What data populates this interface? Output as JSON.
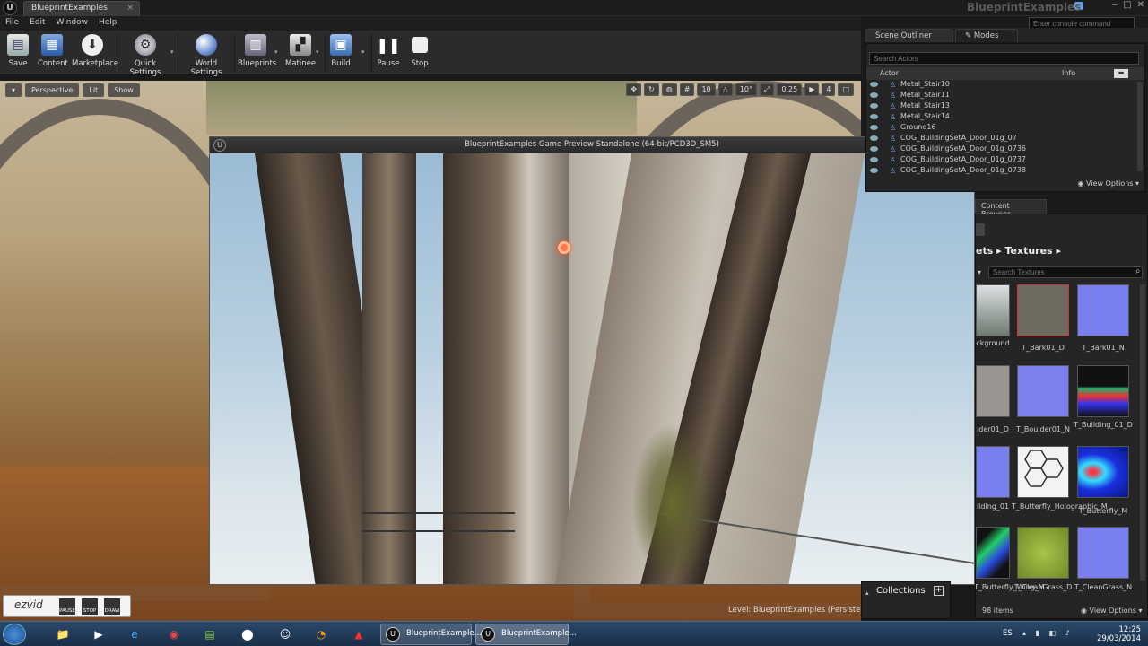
{
  "window": {
    "logo": "U",
    "tab_label": "BlueprintExamples",
    "app_title": "BlueprintExamples",
    "console_placeholder": "Enter console command"
  },
  "menu": [
    "File",
    "Edit",
    "Window",
    "Help"
  ],
  "toolbar": [
    {
      "label": "Save",
      "icon": "save-icon"
    },
    {
      "label": "Content",
      "icon": "content-icon"
    },
    {
      "label": "Marketplace",
      "icon": "marketplace-icon"
    },
    {
      "label": "Quick Settings",
      "icon": "quick-settings-icon"
    },
    {
      "label": "World Settings",
      "icon": "world-settings-icon"
    },
    {
      "label": "Blueprints",
      "icon": "blueprints-icon"
    },
    {
      "label": "Matinee",
      "icon": "matinee-icon"
    },
    {
      "label": "Build",
      "icon": "build-icon"
    },
    {
      "label": "Pause",
      "icon": "pause-icon"
    },
    {
      "label": "Stop",
      "icon": "stop-icon"
    }
  ],
  "viewport": {
    "perspective": "Perspective",
    "lit": "Lit",
    "show": "Show",
    "grid_snap": "10",
    "rot_snap": "10°",
    "scale_snap": "0,25",
    "cam_speed": "4",
    "level_prefix": "Level:",
    "level_name": "BlueprintExamples (Persistent)"
  },
  "recorder": {
    "logo": "ezvid",
    "buttons": [
      "PAUSE",
      "STOP",
      "DRAW"
    ]
  },
  "game_preview": {
    "title": "BlueprintExamples Game Preview Standalone (64-bit/PCD3D_SM5)"
  },
  "outliner": {
    "tab_label": "Scene Outliner",
    "modes_label": "Modes",
    "search_placeholder": "Search Actors",
    "col_actor": "Actor",
    "col_info": "Info",
    "rows": [
      "Metal_Stair10",
      "Metal_Stair11",
      "Metal_Stair13",
      "Metal_Stair14",
      "Ground16",
      "COG_BuildingSetA_Door_01g_07",
      "COG_BuildingSetA_Door_01g_0736",
      "COG_BuildingSetA_Door_01g_0737",
      "COG_BuildingSetA_Door_01g_0738"
    ],
    "view_options": "View Options"
  },
  "content_browser": {
    "tab_label": "Content Browser",
    "breadcrumb": "ets",
    "current_folder": "Textures",
    "search_placeholder": "Search Textures",
    "tiles": [
      {
        "label": "ckground",
        "color": "#cfd3d6"
      },
      {
        "label": "T_Bark01_D",
        "color": "#6f6a60"
      },
      {
        "label": "T_Bark01_N",
        "color": "#7a7ff0"
      },
      {
        "label": "lder01_D",
        "color": "#9a9590"
      },
      {
        "label": "T_Boulder01_N",
        "color": "#7c80ee"
      },
      {
        "label": "T_Building_01_D",
        "color": "#1a1a1a"
      },
      {
        "label": "ilding_01",
        "color": "#7a7ff0"
      },
      {
        "label": "T_Butterfly_Holographic_M",
        "color": "#f3f3f3"
      },
      {
        "label": "T_Butterfly_M",
        "color": "#1a2fe0"
      },
      {
        "label": "T_Butterfly_Wing_M",
        "color": "#1a1a1a"
      },
      {
        "label": "T_CleanGrass_D",
        "color": "#8aa83a"
      },
      {
        "label": "T_CleanGrass_N",
        "color": "#7a7ff0"
      }
    ],
    "collections": "Collections",
    "items_count": "98 items",
    "view_options": "View Options"
  },
  "taskbar": {
    "tasks": [
      "BlueprintExample...",
      "BlueprintExample..."
    ],
    "lang": "ES",
    "time": "12:25",
    "date": "29/03/2014"
  }
}
